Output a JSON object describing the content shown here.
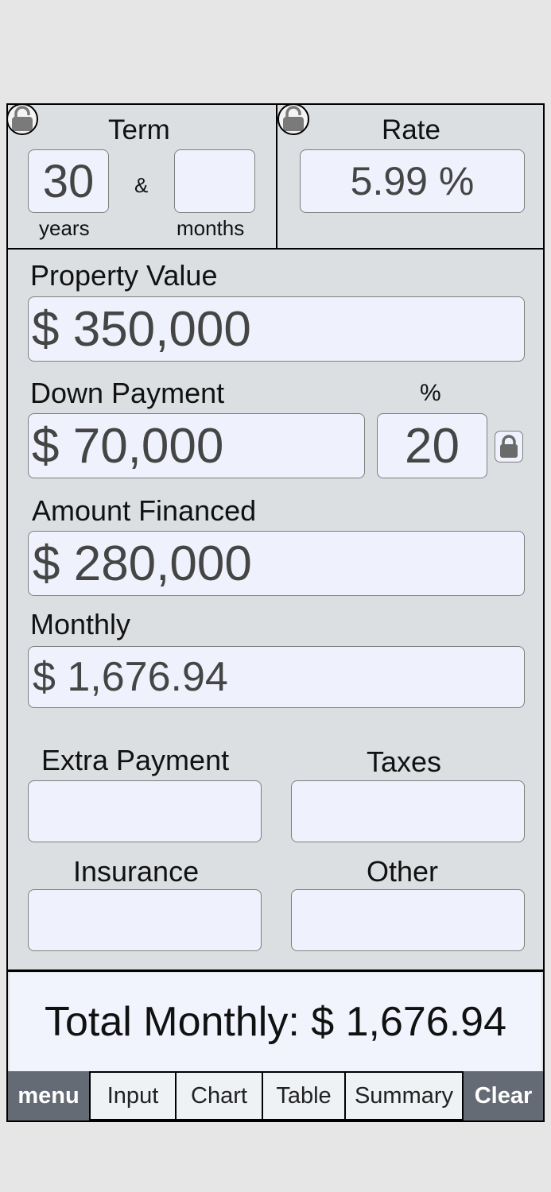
{
  "term": {
    "label": "Term",
    "years_value": "30",
    "years_label": "years",
    "ampersand": "&",
    "months_value": "",
    "months_label": "months"
  },
  "rate": {
    "label": "Rate",
    "value": "5.99 %"
  },
  "property_value": {
    "label": "Property Value",
    "value": "$ 350,000"
  },
  "down_payment": {
    "label": "Down Payment",
    "value": "$ 70,000",
    "percent_label": "%",
    "percent_value": "20"
  },
  "amount_financed": {
    "label": "Amount Financed",
    "value": "$ 280,000"
  },
  "monthly": {
    "label": "Monthly",
    "value": "$ 1,676.94"
  },
  "extra_payment": {
    "label": "Extra Payment",
    "value": ""
  },
  "taxes": {
    "label": "Taxes",
    "value": ""
  },
  "insurance": {
    "label": "Insurance",
    "value": ""
  },
  "other": {
    "label": "Other",
    "value": ""
  },
  "total": {
    "text": "Total Monthly: $ 1,676.94"
  },
  "tabs": {
    "menu": "menu",
    "input": "Input",
    "chart": "Chart",
    "table": "Table",
    "summary": "Summary",
    "clear": "Clear"
  },
  "icons": {
    "term_lock": "lock-open-icon",
    "rate_lock": "lock-open-icon",
    "down_payment_lock": "lock-closed-icon"
  },
  "colors": {
    "panel_bg": "#dcdfe2",
    "field_bg": "#eff2fc",
    "tab_dark": "#656b74",
    "total_bg": "#f1f4fd"
  }
}
